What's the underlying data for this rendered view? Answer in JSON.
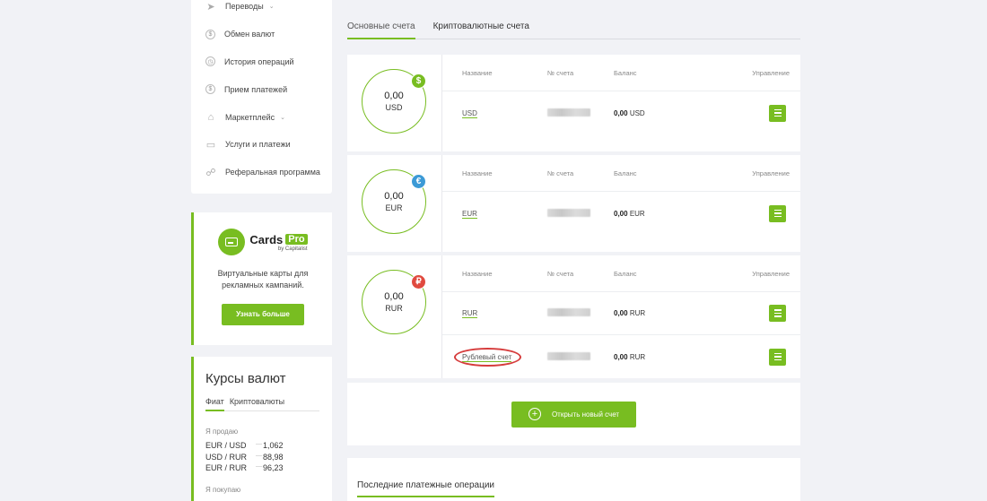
{
  "sidebar": {
    "menu": [
      {
        "label": "Переводы",
        "icon": "send-icon",
        "has_chevron": true
      },
      {
        "label": "Обмен валют",
        "icon": "dollar-icon",
        "has_chevron": false
      },
      {
        "label": "История операций",
        "icon": "clock-icon",
        "has_chevron": false
      },
      {
        "label": "Прием платежей",
        "icon": "wallet-icon",
        "has_chevron": false
      },
      {
        "label": "Маркетплейс",
        "icon": "basket-icon",
        "has_chevron": true
      },
      {
        "label": "Услуги и платежи",
        "icon": "briefcase-icon",
        "has_chevron": false
      },
      {
        "label": "Реферальная программа",
        "icon": "users-icon",
        "has_chevron": false
      }
    ],
    "promo": {
      "logo_main": "Cards",
      "logo_pro": "Pro",
      "logo_sub": "by Capitalist",
      "text": "Виртуальные карты для рекламных кампаний.",
      "button": "Узнать больше"
    },
    "rates": {
      "title": "Курсы валют",
      "tabs": [
        "Фиат",
        "Криптовалюты"
      ],
      "sell_label": "Я продаю",
      "sell_rows": [
        {
          "pair": "EUR / USD",
          "value": "1,062"
        },
        {
          "pair": "USD / RUR",
          "value": "88,98"
        },
        {
          "pair": "EUR / RUR",
          "value": "96,23"
        }
      ],
      "buy_label": "Я покупаю"
    }
  },
  "main": {
    "tabs": [
      "Основные счета",
      "Криптовалютные счета"
    ],
    "columns": {
      "name": "Название",
      "number": "№ счета",
      "balance": "Баланс",
      "control": "Управление"
    },
    "accounts": [
      {
        "amount": "0,00",
        "currency": "USD",
        "badge": "$",
        "badge_color": "#78bd21",
        "rows": [
          {
            "name": "USD",
            "balance_value": "0,00",
            "balance_currency": "USD"
          }
        ]
      },
      {
        "amount": "0,00",
        "currency": "EUR",
        "badge": "€",
        "badge_color": "#3c9ad6",
        "rows": [
          {
            "name": "EUR",
            "balance_value": "0,00",
            "balance_currency": "EUR"
          }
        ]
      },
      {
        "amount": "0,00",
        "currency": "RUR",
        "badge": "₽",
        "badge_color": "#e04a3f",
        "rows": [
          {
            "name": "RUR",
            "balance_value": "0,00",
            "balance_currency": "RUR"
          },
          {
            "name": "Рублевый счет",
            "balance_value": "0,00",
            "balance_currency": "RUR"
          }
        ]
      }
    ],
    "open_account_button": "Открыть новый счет",
    "recent_title": "Последние платежные операции"
  },
  "colors": {
    "accent": "#78bd21",
    "background": "#f1f2f6",
    "highlight": "#d63c3c"
  }
}
